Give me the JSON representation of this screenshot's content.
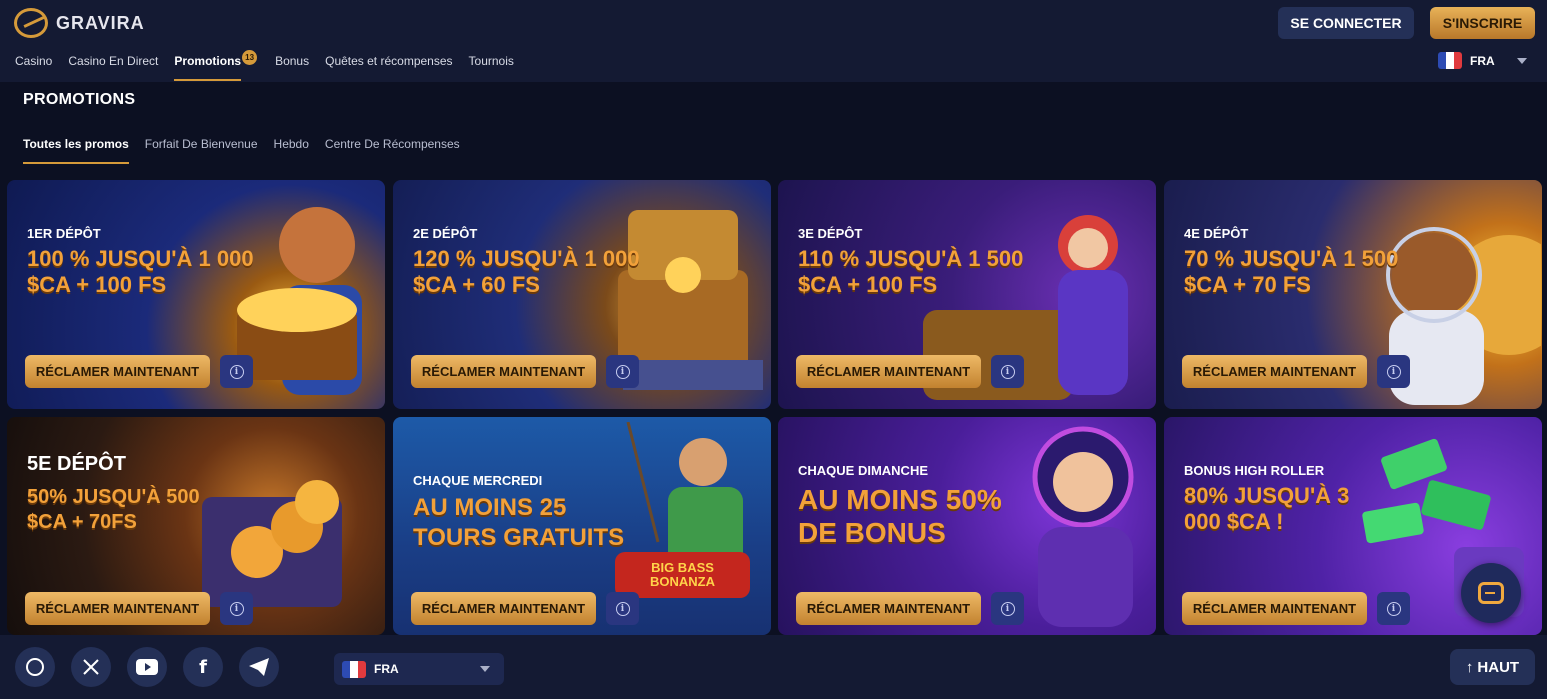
{
  "brand": {
    "name": "GRAVIRA",
    "accent": "#d59a3a"
  },
  "header": {
    "login_label": "SE CONNECTER",
    "register_label": "S'INSCRIRE",
    "nav": [
      {
        "label": "Casino"
      },
      {
        "label": "Casino En Direct"
      },
      {
        "label": "Promotions",
        "badge": "13",
        "active": true
      },
      {
        "label": "Bonus"
      },
      {
        "label": "Quêtes et récompenses"
      },
      {
        "label": "Tournois"
      }
    ],
    "language": "FRA"
  },
  "main": {
    "title": "PROMOTIONS",
    "tabs": [
      {
        "label": "Toutes les promos",
        "active": true
      },
      {
        "label": "Forfait De Bienvenue"
      },
      {
        "label": "Hebdo"
      },
      {
        "label": "Centre De Récompenses"
      }
    ],
    "claim_label": "RÉCLAMER MAINTENANT",
    "cards": [
      {
        "label": "1ER DÉPÔT",
        "headline": "100 % JUSQU'À 1 000 $CA + 100 FS"
      },
      {
        "label": "2E DÉPÔT",
        "headline": "120 % JUSQU'À 1 000 $CA + 60 FS"
      },
      {
        "label": "3E DÉPÔT",
        "headline": "110 % JUSQU'À 1 500 $CA + 100 FS"
      },
      {
        "label": "4E DÉPÔT",
        "headline": "70 % JUSQU'À 1 500 $CA + 70 FS"
      },
      {
        "label": "5E DÉPÔT",
        "headline": "50% JUSQU'À 500 $CA + 70FS"
      },
      {
        "label": "CHAQUE MERCREDI",
        "headline": "AU MOINS 25 TOURS GRATUITS",
        "logo_text": "BIG BASS BONANZA"
      },
      {
        "label": "CHAQUE DIMANCHE",
        "headline": "AU MOINS 50% DE BONUS"
      },
      {
        "label": "BONUS HIGH ROLLER",
        "headline": "80% JUSQU'À 3 000 $CA !"
      }
    ]
  },
  "footer": {
    "socials": [
      "whatsapp-icon",
      "x-icon",
      "youtube-icon",
      "facebook-icon",
      "telegram-icon"
    ],
    "language": "FRA",
    "back_to_top_label": "HAUT"
  }
}
